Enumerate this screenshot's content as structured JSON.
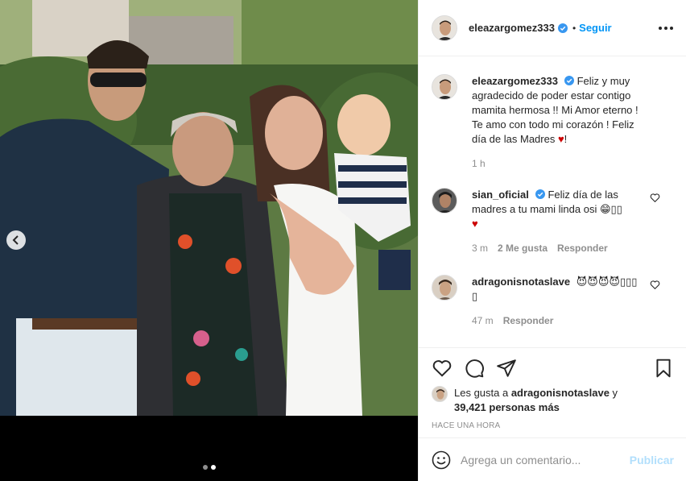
{
  "post": {
    "image_alt": "Foto de familia",
    "carousel": {
      "count": 2,
      "active_index": 1
    }
  },
  "header": {
    "username": "eleazargomez333",
    "verified": true,
    "separator": "•",
    "follow_label": "Seguir",
    "more_icon": "more-options-icon"
  },
  "caption": {
    "username": "eleazargomez333",
    "line1": "Feliz y muy",
    "line2": "agradecido de poder estar contigo",
    "line3": "mamita hermosa !! Mi Amor eterno !",
    "line4": "Te amo con todo mi corazón ! Feliz",
    "line5": "día de las Madres ",
    "heart": "♥",
    "line5_end": "!",
    "time": "1 h"
  },
  "comments": [
    {
      "username": "sian_oficial",
      "text_line1": "Feliz día de las",
      "text_line2": "madres a tu mami linda osi 😁▯▯",
      "text_line3": "♥",
      "time": "3 m",
      "likes": "2 Me gusta",
      "reply": "Responder"
    },
    {
      "username": "adragonisnotaslave",
      "text_line1": "😈😈😈😈▯▯▯",
      "text_line2": "▯",
      "time": "47 m",
      "reply": "Responder"
    }
  ],
  "likes": {
    "prefix": "Les gusta a ",
    "user": "adragonisnotaslave",
    "mid": " y",
    "count": "39,421 personas más"
  },
  "time_ago": "HACE UNA HORA",
  "add_comment": {
    "placeholder": "Agrega un comentario...",
    "publish_label": "Publicar"
  },
  "colors": {
    "accent": "#0095f6",
    "publish_disabled": "#b2dffc",
    "muted": "#8e8e8e",
    "heart": "#cc0000"
  }
}
